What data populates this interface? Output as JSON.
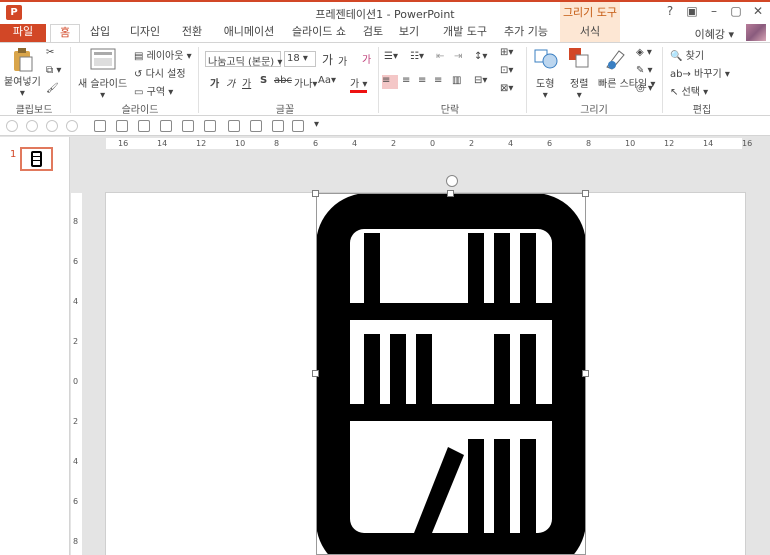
{
  "window": {
    "title": "프레젠테이션1 - PowerPoint",
    "contextual_tab_group": "그리기 도구",
    "controls": [
      "?",
      "▣",
      "–",
      "▢",
      "✕"
    ]
  },
  "tabs": [
    "파일",
    "홈",
    "삽입",
    "디자인",
    "전환",
    "애니메이션",
    "슬라이드 쇼",
    "검토",
    "보기",
    "개발 도구",
    "추가 기능",
    "서식"
  ],
  "active_tab": "홈",
  "user": {
    "name": "이혜강"
  },
  "ribbon": {
    "clipboard": {
      "paste": "붙여넣기",
      "label": "클립보드"
    },
    "slides": {
      "new_slide": "새 슬라이드",
      "layout": "레이아웃",
      "reset": "다시 설정",
      "section": "구역",
      "label": "슬라이드"
    },
    "font": {
      "font_name": "나눔고딕 (본문)",
      "font_size": "18",
      "grow": "가",
      "shrink": "가",
      "clear": "가",
      "bold": "가",
      "italic": "가",
      "underline": "가",
      "strike": "S",
      "shadow": "abc",
      "spacing": "가나",
      "case": "Aa",
      "color": "가",
      "label": "글꼴"
    },
    "paragraph": {
      "label": "단락"
    },
    "drawing": {
      "shapes": "도형",
      "arrange": "정렬",
      "quick_styles": "빠른 스타일",
      "label": "그리기"
    },
    "editing": {
      "find": "찾기",
      "replace": "바꾸기",
      "select": "선택",
      "label": "편집"
    }
  },
  "thumbnail": {
    "slide_number": "1"
  },
  "rulers": {
    "horizontal": [
      "16",
      "14",
      "12",
      "10",
      "8",
      "6",
      "4",
      "2",
      "0",
      "2",
      "4",
      "6",
      "8",
      "10",
      "12",
      "14",
      "16"
    ],
    "vertical": [
      "8",
      "6",
      "4",
      "2",
      "0",
      "2",
      "4",
      "6",
      "8"
    ]
  },
  "colors": {
    "accent": "#d24726",
    "contextual": "#fde7d4",
    "shape": "#000000"
  },
  "icons": {
    "app": "powerpoint-icon",
    "shape": "bookshelf-icon"
  }
}
